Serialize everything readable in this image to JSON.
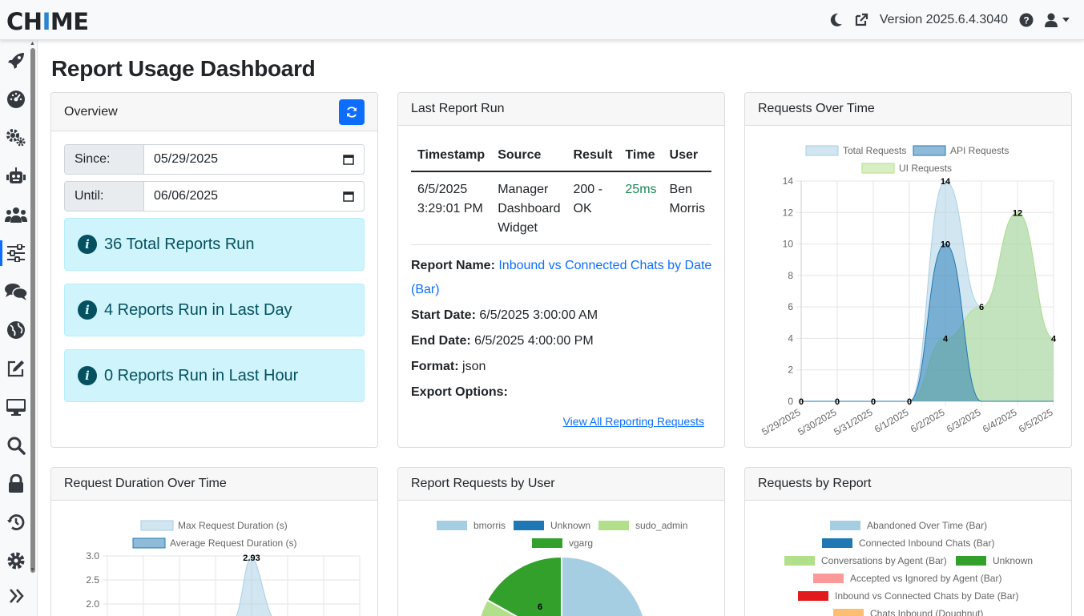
{
  "app": {
    "logo_text_1": "CH",
    "logo_text_2": "I",
    "logo_text_3": "ME",
    "version": "Version 2025.6.4.3040"
  },
  "sidebar": {
    "items": [
      "rocket-icon",
      "dashboard-gauge-icon",
      "gears-icon",
      "robot-icon",
      "users-icon",
      "sliders-icon",
      "comments-icon",
      "globe-icon",
      "edit-icon",
      "desktop-icon",
      "search-icon",
      "lock-icon",
      "history-icon",
      "gear-icon"
    ],
    "active": "sliders-icon"
  },
  "page": {
    "title": "Report Usage Dashboard"
  },
  "overview": {
    "title": "Overview",
    "since_label": "Since:",
    "since_value": "05/29/2025",
    "until_label": "Until:",
    "until_value": "06/06/2025",
    "alerts": [
      "36 Total Reports Run",
      "4 Reports Run in Last Day",
      "0 Reports Run in Last Hour"
    ]
  },
  "last_run": {
    "title": "Last Report Run",
    "columns": [
      "Timestamp",
      "Source",
      "Result",
      "Time",
      "User"
    ],
    "row": {
      "timestamp_1": "6/5/2025",
      "timestamp_2": "3:29:01 PM",
      "source_1": "Manager",
      "source_2": "Dashboard",
      "source_3": "Widget",
      "result_1": "200 -",
      "result_2": "OK",
      "time": "25ms",
      "user_1": "Ben",
      "user_2": "Morris"
    },
    "report_name_label": "Report Name:",
    "report_name_1": "Inbound vs Connected Chats by Date",
    "report_name_2": "(Bar)",
    "start_label": "Start Date:",
    "start_value": "6/5/2025 3:00:00 AM",
    "end_label": "End Date:",
    "end_value": "6/5/2025 4:00:00 PM",
    "format_label": "Format:",
    "format_value": "json",
    "export_label": "Export Options:",
    "view_all": "View All Reporting Requests"
  },
  "requests_over_time": {
    "title": "Requests Over Time"
  },
  "request_duration": {
    "title": "Request Duration Over Time"
  },
  "requests_by_user": {
    "title": "Report Requests by User"
  },
  "requests_by_report": {
    "title": "Requests by Report"
  },
  "chart_data": [
    {
      "type": "area",
      "categories": [
        "5/29/2025",
        "5/30/2025",
        "5/31/2025",
        "6/1/2025",
        "6/2/2025",
        "6/3/2025",
        "6/4/2025",
        "6/5/2025"
      ],
      "series": [
        {
          "name": "Total Requests",
          "values": [
            0,
            0,
            0,
            0,
            14,
            6,
            12,
            4
          ],
          "color": "#a6cee3"
        },
        {
          "name": "API Requests",
          "values": [
            0,
            0,
            0,
            0,
            10,
            0,
            0,
            0
          ],
          "color": "#1f78b4"
        },
        {
          "name": "UI Requests",
          "values": [
            0,
            0,
            0,
            0,
            4,
            6,
            12,
            4
          ],
          "color": "#b2df8a"
        }
      ],
      "ylim": [
        0,
        14
      ],
      "yticks": [
        0,
        2,
        4,
        6,
        8,
        10,
        12,
        14
      ],
      "data_labels": [
        0,
        0,
        0,
        0,
        14,
        6,
        12,
        4
      ],
      "data_labels_2": [
        0,
        0,
        0,
        0,
        10,
        0,
        0,
        0
      ],
      "data_labels_3": [
        4
      ],
      "legend": "top"
    },
    {
      "type": "area",
      "series": [
        {
          "name": "Max Request Duration (s)",
          "color": "#a6cee3"
        },
        {
          "name": "Average Request Duration (s)",
          "color": "#1f78b4"
        }
      ],
      "yticks": [
        "3.0",
        "2.5",
        "2.0"
      ],
      "peak_label": "2.93",
      "legend": "top"
    },
    {
      "type": "pie",
      "labels": [
        "bmorris",
        "Unknown",
        "sudo_admin",
        "vgarg"
      ],
      "colors": [
        "#a6cee3",
        "#1f78b4",
        "#b2df8a",
        "#33a02c"
      ],
      "visible_label": "6",
      "legend": "top"
    },
    {
      "type": "pie",
      "labels": [
        "Abandoned Over Time (Bar)",
        "Connected Inbound Chats (Bar)",
        "Conversations by Agent (Bar)",
        "Unknown",
        "Accepted vs Ignored by Agent (Bar)",
        "Inbound vs Connected Chats by Date (Bar)",
        "Chats Inbound (Doughnut)"
      ],
      "colors": [
        "#a6cee3",
        "#1f78b4",
        "#b2df8a",
        "#33a02c",
        "#fb9a99",
        "#e31a1c",
        "#fdbf6f"
      ],
      "legend": "top"
    }
  ]
}
